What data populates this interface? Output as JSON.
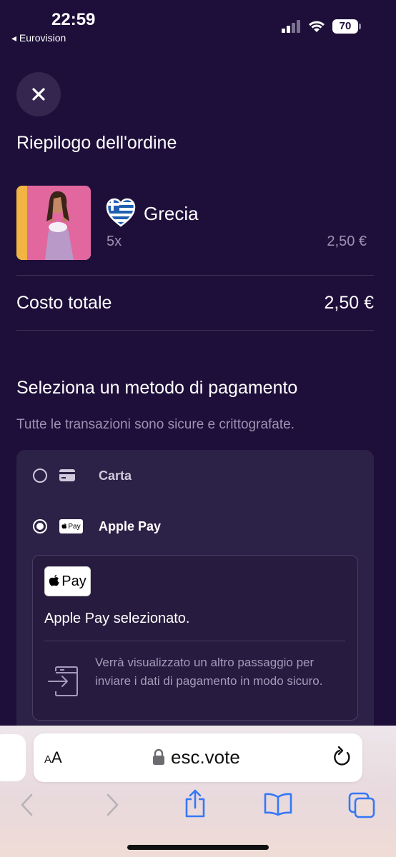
{
  "status_bar": {
    "time": "22:59",
    "back_app": "◂ Eurovision",
    "battery": "70"
  },
  "order": {
    "title": "Riepilogo dell'ordine",
    "item": {
      "country": "Grecia",
      "quantity": "5x",
      "price": "2,50 €"
    },
    "total_label": "Costo totale",
    "total_value": "2,50 €"
  },
  "payment": {
    "title": "Seleziona un metodo di pagamento",
    "subtitle": "Tutte le transazioni sono sicure e crittografate.",
    "options": [
      {
        "label": "Carta",
        "selected": false,
        "icon": "card-icon"
      },
      {
        "label": "Apple Pay",
        "selected": true,
        "icon": "apple-pay-icon"
      }
    ],
    "apple_pay": {
      "logo_text": "Pay",
      "selected_text": "Apple Pay selezionato.",
      "info_text": "Verrà visualizzato un altro passaggio per inviare i dati di pagamento in modo sicuro."
    }
  },
  "browser": {
    "aa_small": "A",
    "aa_large": "A",
    "url": "esc.vote"
  },
  "colors": {
    "background": "#1e0f3a",
    "panel": "#2c2146",
    "muted_text": "#9c93b2",
    "accent_blue": "#3478f6"
  }
}
